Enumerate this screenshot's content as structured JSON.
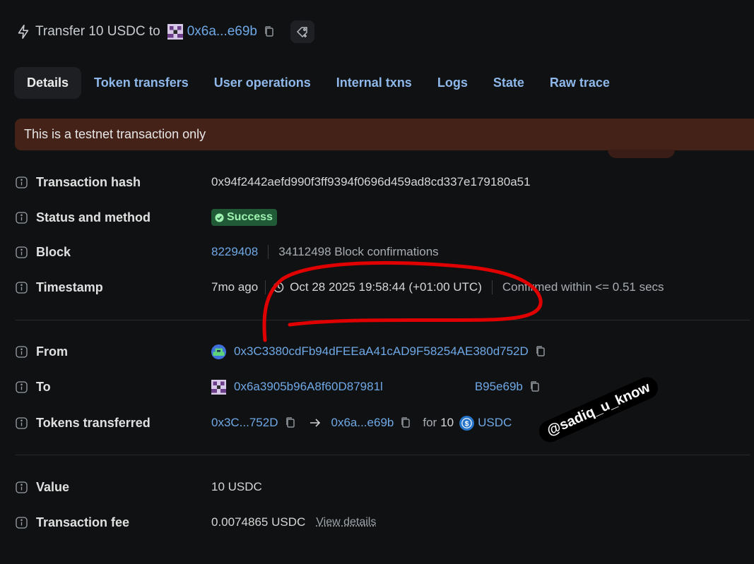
{
  "header": {
    "label": "Transfer 10 USDC to",
    "address": "0x6a...e69b"
  },
  "tabs": [
    "Details",
    "Token transfers",
    "User operations",
    "Internal txns",
    "Logs",
    "State",
    "Raw trace"
  ],
  "banner": "This is a testnet transaction only",
  "rows": {
    "tx_hash": {
      "label": "Transaction hash",
      "value": "0x94f2442aefd990f3ff9394f0696d459ad8cd337e179180a51"
    },
    "status": {
      "label": "Status and method",
      "badge": "Success"
    },
    "block": {
      "label": "Block",
      "number": "8229408",
      "confirmations": "34112498 Block confirmations"
    },
    "timestamp": {
      "label": "Timestamp",
      "ago": "7mo ago",
      "datetime": "Oct 28 2025 19:58:44 (+01:00 UTC)",
      "confirmed": "Confirmed within <= 0.51 secs"
    },
    "from": {
      "label": "From",
      "address": "0x3C3380cdFb94dFEEaA41cAD9F58254AE380d752D"
    },
    "to": {
      "label": "To",
      "address_start": "0x6a3905b96A8f60D87981l",
      "address_end": "B95e69b"
    },
    "tokens": {
      "label": "Tokens transferred",
      "from": "0x3C...752D",
      "to": "0x6a...e69b",
      "for": "for",
      "amount": "10",
      "token": "USDC"
    },
    "value": {
      "label": "Value",
      "value": "10 USDC"
    },
    "fee": {
      "label": "Transaction fee",
      "value": "0.0074865 USDC",
      "link": "View details"
    }
  },
  "watermark": "@sadiq_u_know",
  "colors": {
    "background": "#101112",
    "link": "#6fa8e6",
    "banner": "#452218",
    "success_bg": "#215a36",
    "success_text": "#9ef2b0",
    "scribble": "#e00000"
  }
}
